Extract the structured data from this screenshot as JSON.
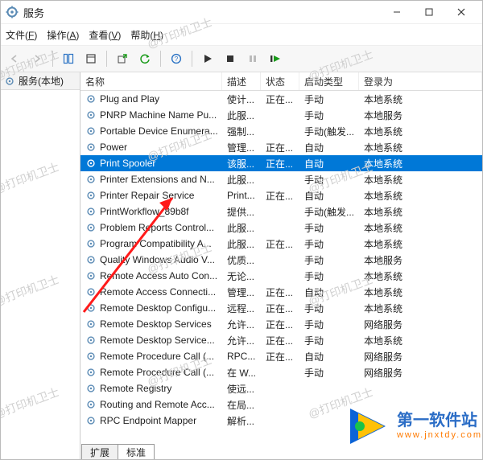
{
  "window": {
    "title": "服务"
  },
  "menu": {
    "file": "文件(F)",
    "action": "操作(A)",
    "view": "查看(V)",
    "help": "帮助(H)"
  },
  "toolbar_icons": [
    "back",
    "forward",
    "up",
    "show-hide",
    "export",
    "refresh",
    "help",
    "play",
    "stop",
    "pause",
    "restart"
  ],
  "sidebar": {
    "label": "服务(本地)"
  },
  "columns": {
    "name": "名称",
    "desc": "描述",
    "status": "状态",
    "start": "启动类型",
    "logon": "登录为"
  },
  "rows": [
    {
      "name": "Plug and Play",
      "desc": "使计...",
      "status": "正在...",
      "start": "手动",
      "logon": "本地系统",
      "selected": false
    },
    {
      "name": "PNRP Machine Name Pu...",
      "desc": "此服...",
      "status": "",
      "start": "手动",
      "logon": "本地服务",
      "selected": false
    },
    {
      "name": "Portable Device Enumera...",
      "desc": "强制...",
      "status": "",
      "start": "手动(触发...",
      "logon": "本地系统",
      "selected": false
    },
    {
      "name": "Power",
      "desc": "管理...",
      "status": "正在...",
      "start": "自动",
      "logon": "本地系统",
      "selected": false
    },
    {
      "name": "Print Spooler",
      "desc": "该服...",
      "status": "正在...",
      "start": "自动",
      "logon": "本地系统",
      "selected": true
    },
    {
      "name": "Printer Extensions and N...",
      "desc": "此服...",
      "status": "",
      "start": "手动",
      "logon": "本地系统",
      "selected": false
    },
    {
      "name": "Printer Repair Service",
      "desc": "Print...",
      "status": "正在...",
      "start": "自动",
      "logon": "本地系统",
      "selected": false
    },
    {
      "name": "PrintWorkflow_89b8f",
      "desc": "提供...",
      "status": "",
      "start": "手动(触发...",
      "logon": "本地系统",
      "selected": false
    },
    {
      "name": "Problem Reports Control...",
      "desc": "此服...",
      "status": "",
      "start": "手动",
      "logon": "本地系统",
      "selected": false
    },
    {
      "name": "Program Compatibility A...",
      "desc": "此服...",
      "status": "正在...",
      "start": "手动",
      "logon": "本地系统",
      "selected": false
    },
    {
      "name": "Quality Windows Audio V...",
      "desc": "优质...",
      "status": "",
      "start": "手动",
      "logon": "本地服务",
      "selected": false
    },
    {
      "name": "Remote Access Auto Con...",
      "desc": "无论...",
      "status": "",
      "start": "手动",
      "logon": "本地系统",
      "selected": false
    },
    {
      "name": "Remote Access Connecti...",
      "desc": "管理...",
      "status": "正在...",
      "start": "自动",
      "logon": "本地系统",
      "selected": false
    },
    {
      "name": "Remote Desktop Configu...",
      "desc": "远程...",
      "status": "正在...",
      "start": "手动",
      "logon": "本地系统",
      "selected": false
    },
    {
      "name": "Remote Desktop Services",
      "desc": "允许...",
      "status": "正在...",
      "start": "手动",
      "logon": "网络服务",
      "selected": false
    },
    {
      "name": "Remote Desktop Service...",
      "desc": "允许...",
      "status": "正在...",
      "start": "手动",
      "logon": "本地系统",
      "selected": false
    },
    {
      "name": "Remote Procedure Call (...",
      "desc": "RPC...",
      "status": "正在...",
      "start": "自动",
      "logon": "网络服务",
      "selected": false
    },
    {
      "name": "Remote Procedure Call (...",
      "desc": "在 W...",
      "status": "",
      "start": "手动",
      "logon": "网络服务",
      "selected": false
    },
    {
      "name": "Remote Registry",
      "desc": "使远...",
      "status": "",
      "start": "",
      "logon": "",
      "selected": false
    },
    {
      "name": "Routing and Remote Acc...",
      "desc": "在局...",
      "status": "",
      "start": "",
      "logon": "",
      "selected": false
    },
    {
      "name": "RPC Endpoint Mapper",
      "desc": "解析...",
      "status": "",
      "start": "",
      "logon": "",
      "selected": false
    }
  ],
  "tabs": {
    "extended": "扩展",
    "standard": "标准"
  },
  "watermark": "@打印机卫士",
  "overlay": {
    "title": "第一软件站",
    "url": "www.jnxtdy.com"
  }
}
